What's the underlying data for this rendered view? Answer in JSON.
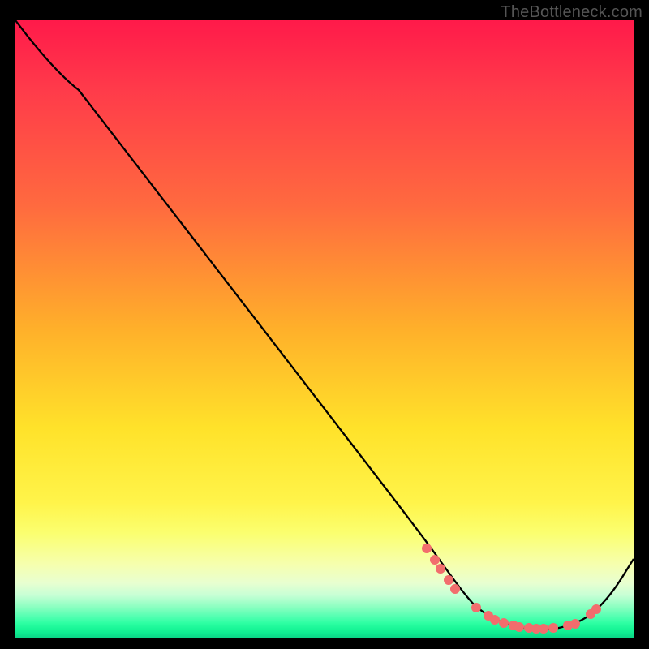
{
  "watermark": "TheBottleneck.com",
  "chart_data": {
    "type": "line",
    "title": "",
    "xlabel": "",
    "ylabel": "",
    "xlim": [
      0,
      100
    ],
    "ylim": [
      0,
      100
    ],
    "x": [
      0,
      10,
      20,
      30,
      40,
      50,
      60,
      67,
      70,
      73,
      76,
      78,
      80,
      82,
      84,
      86,
      88,
      90,
      92,
      94,
      96,
      98,
      100
    ],
    "y": [
      100,
      91,
      78,
      65,
      52,
      39,
      26,
      14,
      9,
      6,
      4,
      3,
      2.5,
      2.2,
      2.1,
      2.1,
      2.2,
      2.5,
      3.5,
      5.5,
      9,
      13,
      17
    ],
    "markers": {
      "x": [
        66.5,
        67.8,
        68.5,
        70,
        71.2,
        74.5,
        76.5,
        77.5,
        79,
        80.5,
        81.5,
        83,
        84.2,
        85.4,
        87,
        89.3,
        90.5,
        93.0,
        93.8
      ],
      "y": [
        14.5,
        13,
        12,
        10,
        8.5,
        5.2,
        4,
        3.5,
        3,
        2.8,
        2.6,
        2.5,
        2.4,
        2.4,
        2.4,
        2.6,
        2.9,
        4.5,
        5.2
      ]
    },
    "series": [
      {
        "name": "curve",
        "values_ref": "x_y_above"
      }
    ],
    "background": "heat-gradient-red-yellow-green",
    "grid": false,
    "legend": false
  }
}
